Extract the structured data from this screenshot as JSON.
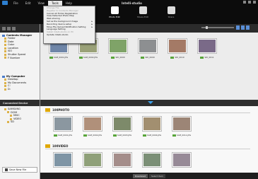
{
  "app": {
    "brand": "Intelli-studio"
  },
  "menu": {
    "items": [
      "File",
      "Edit",
      "View",
      "Tools",
      "Help"
    ]
  },
  "modes": [
    {
      "label": "Photo Edit"
    },
    {
      "label": "Movie Edit"
    },
    {
      "label": "Share"
    }
  ],
  "dropdown": {
    "items": [
      {
        "label": "Change File",
        "disabled": true
      },
      {
        "label": "Register to Contents Manager",
        "disabled": true
      },
      {
        "label": "Cancel All Folder Registration",
        "disabled": false
      },
      {
        "label": "View Detected Photo Map",
        "disabled": false
      },
      {
        "label": "Web sharing",
        "disabled": false
      },
      {
        "label": "Set as the background image",
        "disabled": false,
        "submenu": true
      },
      {
        "label": "Recording device setup",
        "disabled": false,
        "submenu": true
      },
      {
        "label": "Move File Upload Notification Setting",
        "disabled": false,
        "submenu": true
      },
      {
        "label": "Language Setting",
        "disabled": false
      },
      {
        "label": "Install Intelli-studio on PC",
        "disabled": true
      },
      {
        "label": "Update Intelli-studio",
        "disabled": false
      }
    ]
  },
  "contents_manager": {
    "title": "Contents Manager",
    "items": [
      "Folder",
      "Date",
      "Color",
      "Location",
      "ISO",
      "Shutter Speed",
      "F Number"
    ]
  },
  "my_computer": {
    "title": "My Computer",
    "items": [
      "Desktop",
      "My Documents",
      "C:",
      "D:"
    ]
  },
  "top_thumbs": [
    {
      "name": "SAM_0001.JPG",
      "color": "#6f86a8"
    },
    {
      "name": "SAM_0002.JPG",
      "color": "#9aa178"
    },
    {
      "name": "SDI_0000",
      "color": "#7fa368"
    },
    {
      "name": "SDI_0009",
      "color": "#8d8f91"
    },
    {
      "name": "SDI_0010",
      "color": "#a47a66"
    },
    {
      "name": "SDI_0011",
      "color": "#7a6a88"
    }
  ],
  "connected": {
    "title": "Connected Device",
    "tree": [
      "SAMSUNG",
      "DCIM",
      "MISC",
      "VIDEO",
      "SD"
    ],
    "save_label": "Save New File"
  },
  "groups": [
    {
      "name": "100PHOTO",
      "thumbs": [
        {
          "name": "SAM_0001.JPG",
          "color": "#8b97a0"
        },
        {
          "name": "SAM_0002.JPG",
          "color": "#b0907a"
        },
        {
          "name": "SAM_0003.JPG",
          "color": "#7d8a6a"
        },
        {
          "name": "SAM_0004.JPG",
          "color": "#a28f70"
        },
        {
          "name": "SAM_0011.JPG",
          "color": "#9c8576"
        }
      ]
    },
    {
      "name": "100VIDEO",
      "thumbs": [
        {
          "name": "SAM_0001.MP4",
          "color": "#7f95a5"
        },
        {
          "name": "SAM_0002.MP4",
          "color": "#8fa079"
        },
        {
          "name": "SAM_0003.MP4",
          "color": "#a48d8a"
        },
        {
          "name": "SAM_0004.MP4",
          "color": "#7b8f76"
        },
        {
          "name": "SAM_0005.MP4",
          "color": "#978a97"
        }
      ]
    }
  ],
  "footer": {
    "tabs": [
      "Download",
      "Select Item"
    ]
  }
}
